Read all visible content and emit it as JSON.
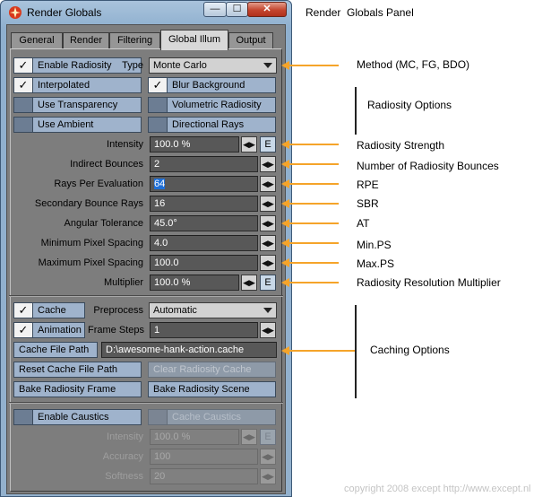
{
  "window": {
    "title": "Render Globals",
    "controls": {
      "minimize": "—",
      "maximize": "☐",
      "close": "✕"
    }
  },
  "tabs": [
    {
      "label": "General",
      "active": false
    },
    {
      "label": "Render",
      "active": false
    },
    {
      "label": "Filtering",
      "active": false
    },
    {
      "label": "Global Illum",
      "active": true
    },
    {
      "label": "Output",
      "active": false
    }
  ],
  "radiosity": {
    "enable_label": "Enable Radiosity",
    "enable_checked": true,
    "type_label": "Type",
    "type_value": "Monte Carlo",
    "interpolated_label": "Interpolated",
    "interpolated_checked": true,
    "blur_background_label": "Blur Background",
    "blur_background_checked": true,
    "use_transparency_label": "Use Transparency",
    "use_transparency_checked": false,
    "volumetric_radiosity_label": "Volumetric Radiosity",
    "volumetric_radiosity_checked": false,
    "use_ambient_label": "Use Ambient",
    "use_ambient_checked": false,
    "directional_rays_label": "Directional Rays",
    "directional_rays_checked": false
  },
  "settings": {
    "intensity": {
      "label": "Intensity",
      "value": "100.0 %"
    },
    "indirect_bounces": {
      "label": "Indirect Bounces",
      "value": "2"
    },
    "rays_per_evaluation": {
      "label": "Rays Per Evaluation",
      "value": "64"
    },
    "secondary_bounce_rays": {
      "label": "Secondary Bounce Rays",
      "value": "16"
    },
    "angular_tolerance": {
      "label": "Angular Tolerance",
      "value": "45.0°"
    },
    "min_pixel_spacing": {
      "label": "Minimum Pixel Spacing",
      "value": "4.0"
    },
    "max_pixel_spacing": {
      "label": "Maximum Pixel Spacing",
      "value": "100.0"
    },
    "multiplier": {
      "label": "Multiplier",
      "value": "100.0 %"
    },
    "envelope_button": "E",
    "spin_glyph": "◀▶"
  },
  "cache": {
    "cache_label": "Cache",
    "cache_checked": true,
    "preprocess_label": "Preprocess",
    "preprocess_value": "Automatic",
    "animation_label": "Animation",
    "animation_checked": true,
    "frame_steps_label": "Frame Steps",
    "frame_steps_value": "1",
    "cache_file_path_button": "Cache File Path",
    "cache_file_path_value": "D:\\awesome-hank-action.cache",
    "reset_button": "Reset Cache File Path",
    "clear_button": "Clear Radiosity Cache",
    "bake_frame_button": "Bake Radiosity Frame",
    "bake_scene_button": "Bake Radiosity Scene"
  },
  "caustics": {
    "enable_label": "Enable Caustics",
    "enable_checked": false,
    "cache_caustics_label": "Cache Caustics",
    "intensity": {
      "label": "Intensity",
      "value": "100.0 %"
    },
    "accuracy": {
      "label": "Accuracy",
      "value": "100"
    },
    "softness": {
      "label": "Softness",
      "value": "20"
    }
  },
  "annotations": {
    "title": "Render  Globals Panel",
    "method": "Method (MC, FG, BDO)",
    "radiosity_options": "Radiosity Options",
    "strength": "Radiosity Strength",
    "bounces": "Number of Radiosity Bounces",
    "rpe": "RPE",
    "sbr": "SBR",
    "at": "AT",
    "min_ps": "Min.PS",
    "max_ps": "Max.PS",
    "multiplier": "Radiosity Resolution Multiplier",
    "caching_options": "Caching Options",
    "copyright": "copyright 2008 except http://www.except.nl"
  },
  "colors": {
    "arrow": "#f5a42a",
    "button": "#9fb3cc",
    "field": "#585858"
  }
}
